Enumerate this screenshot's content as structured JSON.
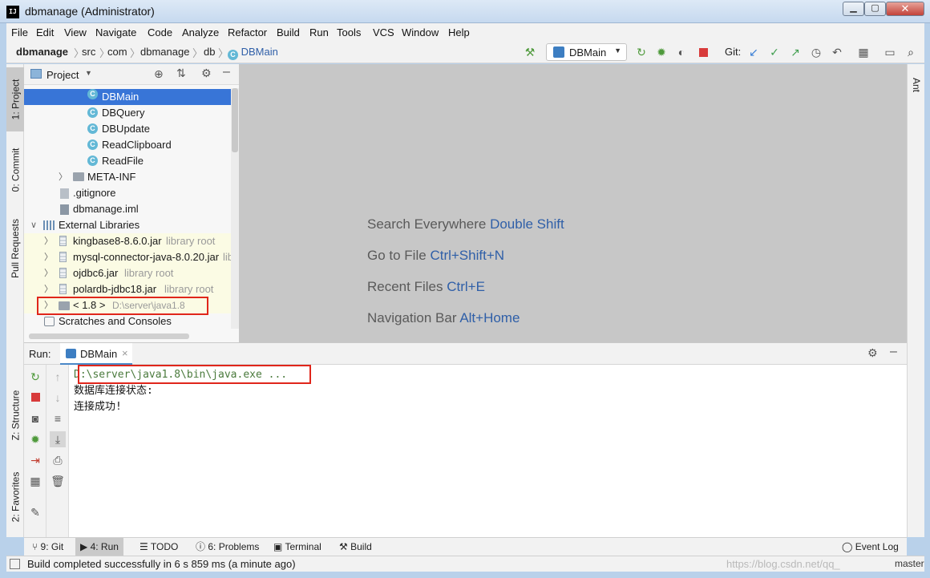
{
  "window": {
    "title": "dbmanage (Administrator)",
    "app_icon": "IJ"
  },
  "menu": [
    "File",
    "Edit",
    "View",
    "Navigate",
    "Code",
    "Analyze",
    "Refactor",
    "Build",
    "Run",
    "Tools",
    "VCS",
    "Window",
    "Help"
  ],
  "breadcrumb": [
    "dbmanage",
    "src",
    "com",
    "dbmanage",
    "db",
    "DBMain"
  ],
  "toolbar": {
    "run_config": "DBMain",
    "git_label": "Git:"
  },
  "side_tabs": {
    "project": "1: Project",
    "commit": "0: Commit",
    "pull_requests": "Pull Requests",
    "structure": "Z: Structure",
    "favorites": "2: Favorites",
    "ant": "Ant"
  },
  "project": {
    "title": "Project",
    "tree": [
      {
        "label": "DBMain",
        "hint": "",
        "kind": "class",
        "selected": true
      },
      {
        "label": "DBQuery",
        "hint": "",
        "kind": "class"
      },
      {
        "label": "DBUpdate",
        "hint": "",
        "kind": "class"
      },
      {
        "label": "ReadClipboard",
        "hint": "",
        "kind": "class"
      },
      {
        "label": "ReadFile",
        "hint": "",
        "kind": "class"
      },
      {
        "label": "META-INF",
        "hint": "",
        "kind": "folder"
      },
      {
        "label": ".gitignore",
        "hint": "",
        "kind": "file"
      },
      {
        "label": "dbmanage.iml",
        "hint": "",
        "kind": "file"
      },
      {
        "label": "External Libraries",
        "hint": "",
        "kind": "libs"
      },
      {
        "label": "kingbase8-8.6.0.jar",
        "hint": "library root",
        "kind": "jar"
      },
      {
        "label": "mysql-connector-java-8.0.20.jar",
        "hint": "libr",
        "kind": "jar"
      },
      {
        "label": "ojdbc6.jar",
        "hint": "library root",
        "kind": "jar"
      },
      {
        "label": "polardb-jdbc18.jar",
        "hint": "library root",
        "kind": "jar"
      },
      {
        "label": "< 1.8 >",
        "hint": "D:\\server\\java1.8",
        "kind": "sdk"
      },
      {
        "label": "Scratches and Consoles",
        "hint": "",
        "kind": "scratch"
      }
    ]
  },
  "editor_hints": [
    {
      "text": "Search Everywhere",
      "key": "Double Shift"
    },
    {
      "text": "Go to File",
      "key": "Ctrl+Shift+N"
    },
    {
      "text": "Recent Files",
      "key": "Ctrl+E"
    },
    {
      "text": "Navigation Bar",
      "key": "Alt+Home"
    }
  ],
  "run": {
    "label": "Run:",
    "tab": "DBMain",
    "close": "×",
    "console": [
      "D:\\server\\java1.8\\bin\\java.exe ...",
      "数据库连接状态:",
      "连接成功!"
    ]
  },
  "bottom_tabs": [
    "9: Git",
    "4: Run",
    "TODO",
    "6: Problems",
    "Terminal",
    "Build",
    "Event Log"
  ],
  "status": {
    "message": "Build completed successfully in 6 s 859 ms (a minute ago)",
    "branch": "master",
    "watermark": "https://blog.csdn.net/qq_"
  },
  "colors": {
    "selection": "#3875d7",
    "highlight_box": "#e0261b",
    "key_hint": "#2f5fa8"
  }
}
